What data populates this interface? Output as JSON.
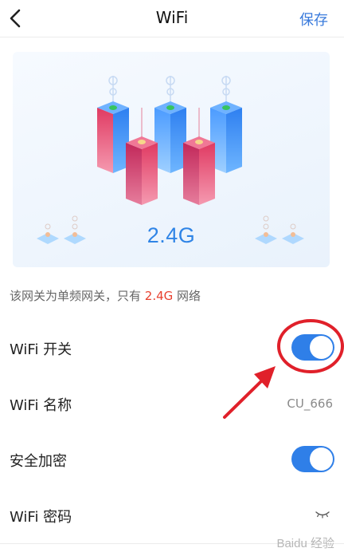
{
  "header": {
    "title": "WiFi",
    "save_label": "保存",
    "back_icon": "chevron-left-icon"
  },
  "banner": {
    "band": "2.4G"
  },
  "notice": {
    "before": "该网关为单频网关，只有 ",
    "highlight": "2.4G",
    "after": " 网络",
    "highlight_color": "#e8412f"
  },
  "settings": {
    "wifi_switch": {
      "label": "WiFi 开关",
      "on": true
    },
    "wifi_name": {
      "label": "WiFi 名称",
      "value": "CU_666"
    },
    "encryption": {
      "label": "安全加密",
      "on": true
    },
    "wifi_password": {
      "label": "WiFi 密码",
      "icon": "eye-closed-icon"
    }
  },
  "colors": {
    "accent": "#2f7fe8",
    "annotation": "#e0202a"
  },
  "watermark": "Baidu 经验"
}
